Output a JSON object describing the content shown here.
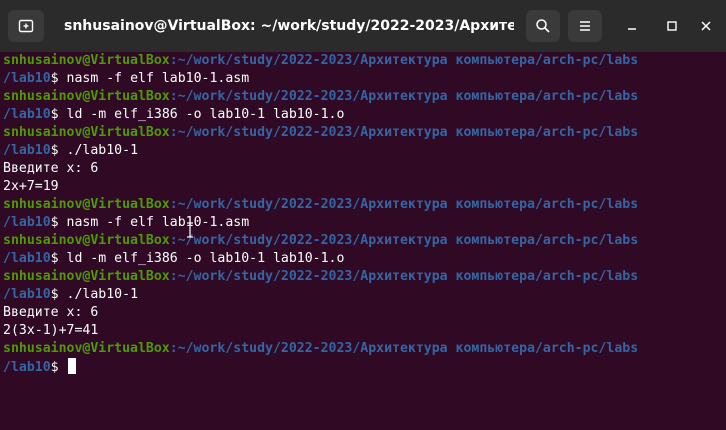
{
  "window": {
    "title": "snhusainov@VirtualBox: ~/work/study/2022-2023/Архитект...",
    "icons": {
      "new_tab": "new-tab-icon",
      "search": "search-icon",
      "menu": "hamburger-menu-icon",
      "minimize": "minimize-icon",
      "maximize": "maximize-icon",
      "close": "close-icon"
    }
  },
  "colors": {
    "background": "#300a24",
    "titlebar": "#2b2b2b",
    "user": "#4e9a06",
    "path": "#3465a4",
    "text": "#ffffff"
  },
  "terminal": {
    "user_host": "snhusainov@VirtualBox",
    "path_wrap": ":~/work/study/2022-2023/Архитектура компьютера/arch-pc/labs",
    "path_cont": "/lab10",
    "prompt_symbol": "$",
    "lines": [
      "nasm -f elf lab10-1.asm",
      "ld -m elf_i386 -o lab10-1 lab10-1.o",
      "./lab10-1",
      "Введите х: 6",
      "2x+7=19",
      "nasm -f elf lab10-1.asm",
      "ld -m elf_i386 -o lab10-1 lab10-1.o",
      "./lab10-1",
      "Введите х: 6",
      "2(3x-1)+7=41"
    ]
  }
}
